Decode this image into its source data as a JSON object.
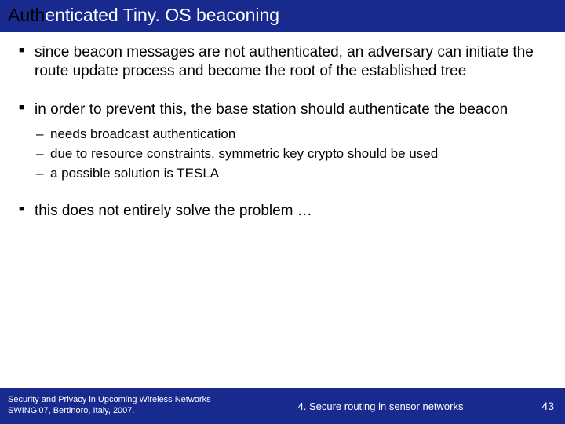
{
  "title": {
    "prefix": "Auth",
    "rest": "enticated Tiny. OS beaconing"
  },
  "bullets": [
    {
      "text": "since beacon messages are not authenticated, an adversary can initiate the route update process and become the root of the established tree",
      "sub": []
    },
    {
      "text": "in order to prevent this, the base station should authenticate the beacon",
      "sub": [
        "needs broadcast authentication",
        "due to resource constraints, symmetric key crypto should be used",
        "a possible solution is TESLA"
      ]
    },
    {
      "text": "this does not entirely solve the problem …",
      "sub": []
    }
  ],
  "footer": {
    "left_line1": "Security and Privacy in Upcoming Wireless Networks",
    "left_line2": "SWING'07, Bertinoro, Italy, 2007.",
    "center": "4. Secure routing in sensor networks",
    "page": "43"
  }
}
